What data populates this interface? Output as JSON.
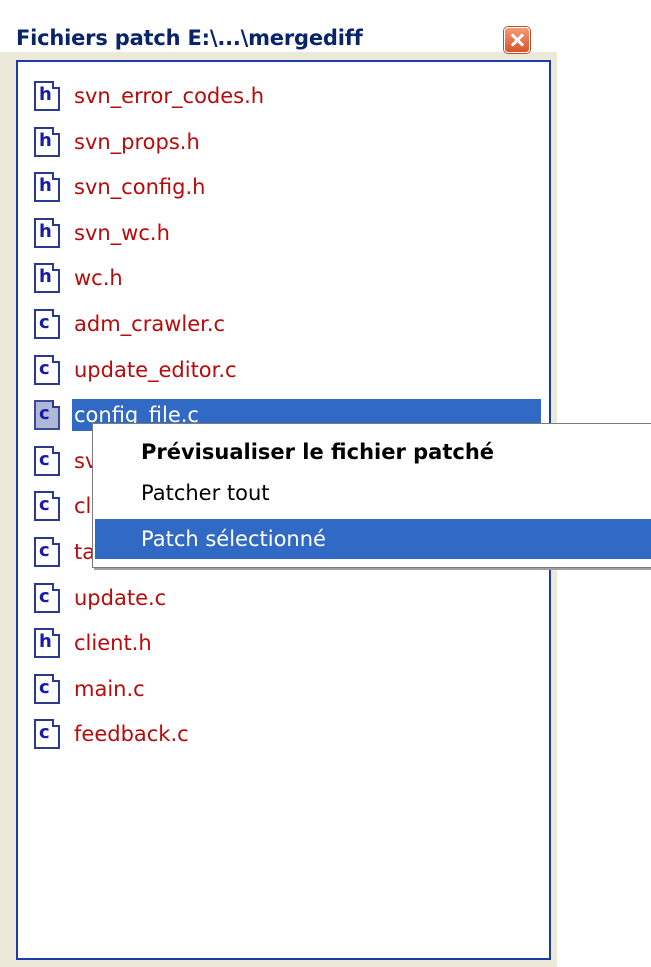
{
  "window": {
    "title": "Fichiers patch  E:\\...\\mergediff",
    "close_icon": "close-icon"
  },
  "files": [
    {
      "name": "svn_error_codes.h",
      "icon": "h-file-icon",
      "icon_letter": "h"
    },
    {
      "name": "svn_props.h",
      "icon": "h-file-icon",
      "icon_letter": "h"
    },
    {
      "name": "svn_config.h",
      "icon": "h-file-icon",
      "icon_letter": "h"
    },
    {
      "name": "svn_wc.h",
      "icon": "h-file-icon",
      "icon_letter": "h"
    },
    {
      "name": "wc.h",
      "icon": "h-file-icon",
      "icon_letter": "h"
    },
    {
      "name": "adm_crawler.c",
      "icon": "c-file-icon",
      "icon_letter": "c"
    },
    {
      "name": "update_editor.c",
      "icon": "c-file-icon",
      "icon_letter": "c"
    },
    {
      "name": "config_file.c",
      "icon": "c-file-icon",
      "icon_letter": "c",
      "selected": true
    },
    {
      "name": "sv",
      "icon": "c-file-icon",
      "icon_letter": "c"
    },
    {
      "name": "cl",
      "icon": "c-file-icon",
      "icon_letter": "c"
    },
    {
      "name": "ta",
      "icon": "c-file-icon",
      "icon_letter": "c"
    },
    {
      "name": "update.c",
      "icon": "c-file-icon",
      "icon_letter": "c"
    },
    {
      "name": "client.h",
      "icon": "h-file-icon",
      "icon_letter": "h"
    },
    {
      "name": "main.c",
      "icon": "c-file-icon",
      "icon_letter": "c"
    },
    {
      "name": "feedback.c",
      "icon": "c-file-icon",
      "icon_letter": "c"
    }
  ],
  "context_menu": {
    "items": [
      {
        "label": "Prévisualiser le fichier patché",
        "default": true
      },
      {
        "label": "Patcher tout"
      },
      {
        "label": "Patch sélectionné",
        "highlighted": true
      }
    ]
  },
  "colors": {
    "title_text": "#0a246a",
    "file_text": "#b80a0a",
    "selection": "#316ac5",
    "panel_border": "#1c3da8",
    "window_frame": "#ece9d8"
  }
}
